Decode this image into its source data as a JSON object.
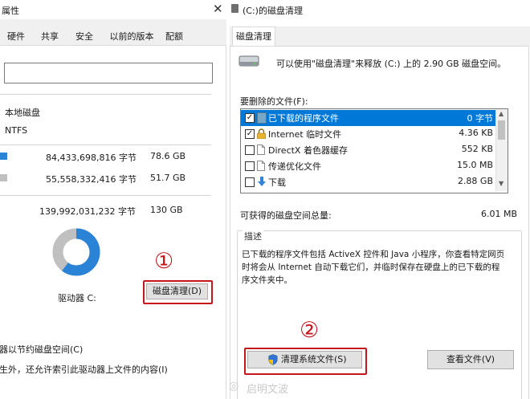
{
  "left_window": {
    "title": "属性",
    "tabs": [
      "硬件",
      "共享",
      "安全",
      "以前的版本",
      "配额"
    ],
    "disk_type": "本地磁盘",
    "file_system": "NTFS",
    "used_bytes": "84,433,698,816 字节",
    "used_gb": "78.6 GB",
    "free_bytes": "55,558,332,416 字节",
    "free_gb": "51.7 GB",
    "capacity_bytes": "139,992,031,232 字节",
    "capacity_gb": "130 GB",
    "usage_fraction": 0.603,
    "drive_label": "驱动器 C:",
    "cleanup_button": "磁盘清理(D)",
    "compress_option": "器以节约磁盘空间(C)",
    "index_option": "生外，还允许索引此驱动器上文件的内容(I)",
    "colors": {
      "used": "#2b83d6",
      "free": "#c0c0c0",
      "highlight": "#c4161c"
    }
  },
  "right_window": {
    "title": "(C:)的磁盘清理",
    "tab": "磁盘清理",
    "intro": "可以使用\"磁盘清理\"来释放  (C:) 上的 2.90 GB 磁盘空间。",
    "files_label": "要删除的文件(F):",
    "files": [
      {
        "name": "已下载的程序文件",
        "size": "0 字节",
        "checked": true,
        "selected": true,
        "icon": "folder-icon"
      },
      {
        "name": "Internet 临时文件",
        "size": "4.36 KB",
        "checked": true,
        "selected": false,
        "icon": "lock-icon"
      },
      {
        "name": "DirectX 着色器缓存",
        "size": "552 KB",
        "checked": false,
        "selected": false,
        "icon": "file-icon"
      },
      {
        "name": "传递优化文件",
        "size": "15.0 MB",
        "checked": false,
        "selected": false,
        "icon": "file-icon"
      },
      {
        "name": "下载",
        "size": "2.88 GB",
        "checked": false,
        "selected": false,
        "icon": "download-icon"
      }
    ],
    "total_label": "可获得的磁盘空间总量:",
    "total_value": "6.01 MB",
    "description_title": "描述",
    "description": "已下载的程序文件包括 ActiveX 控件和 Java 小程序，你查看特定网页时将会从 Internet 自动下载它们，并临时保存在硬盘上的已下载的程序文件夹中。",
    "clean_system_button": "清理系统文件(S)",
    "view_files_button": "查看文件(V)",
    "colors": {
      "selection": "#0078d7"
    }
  },
  "annotations": {
    "step1": "①",
    "step2": "②"
  },
  "watermark": "启明文波"
}
